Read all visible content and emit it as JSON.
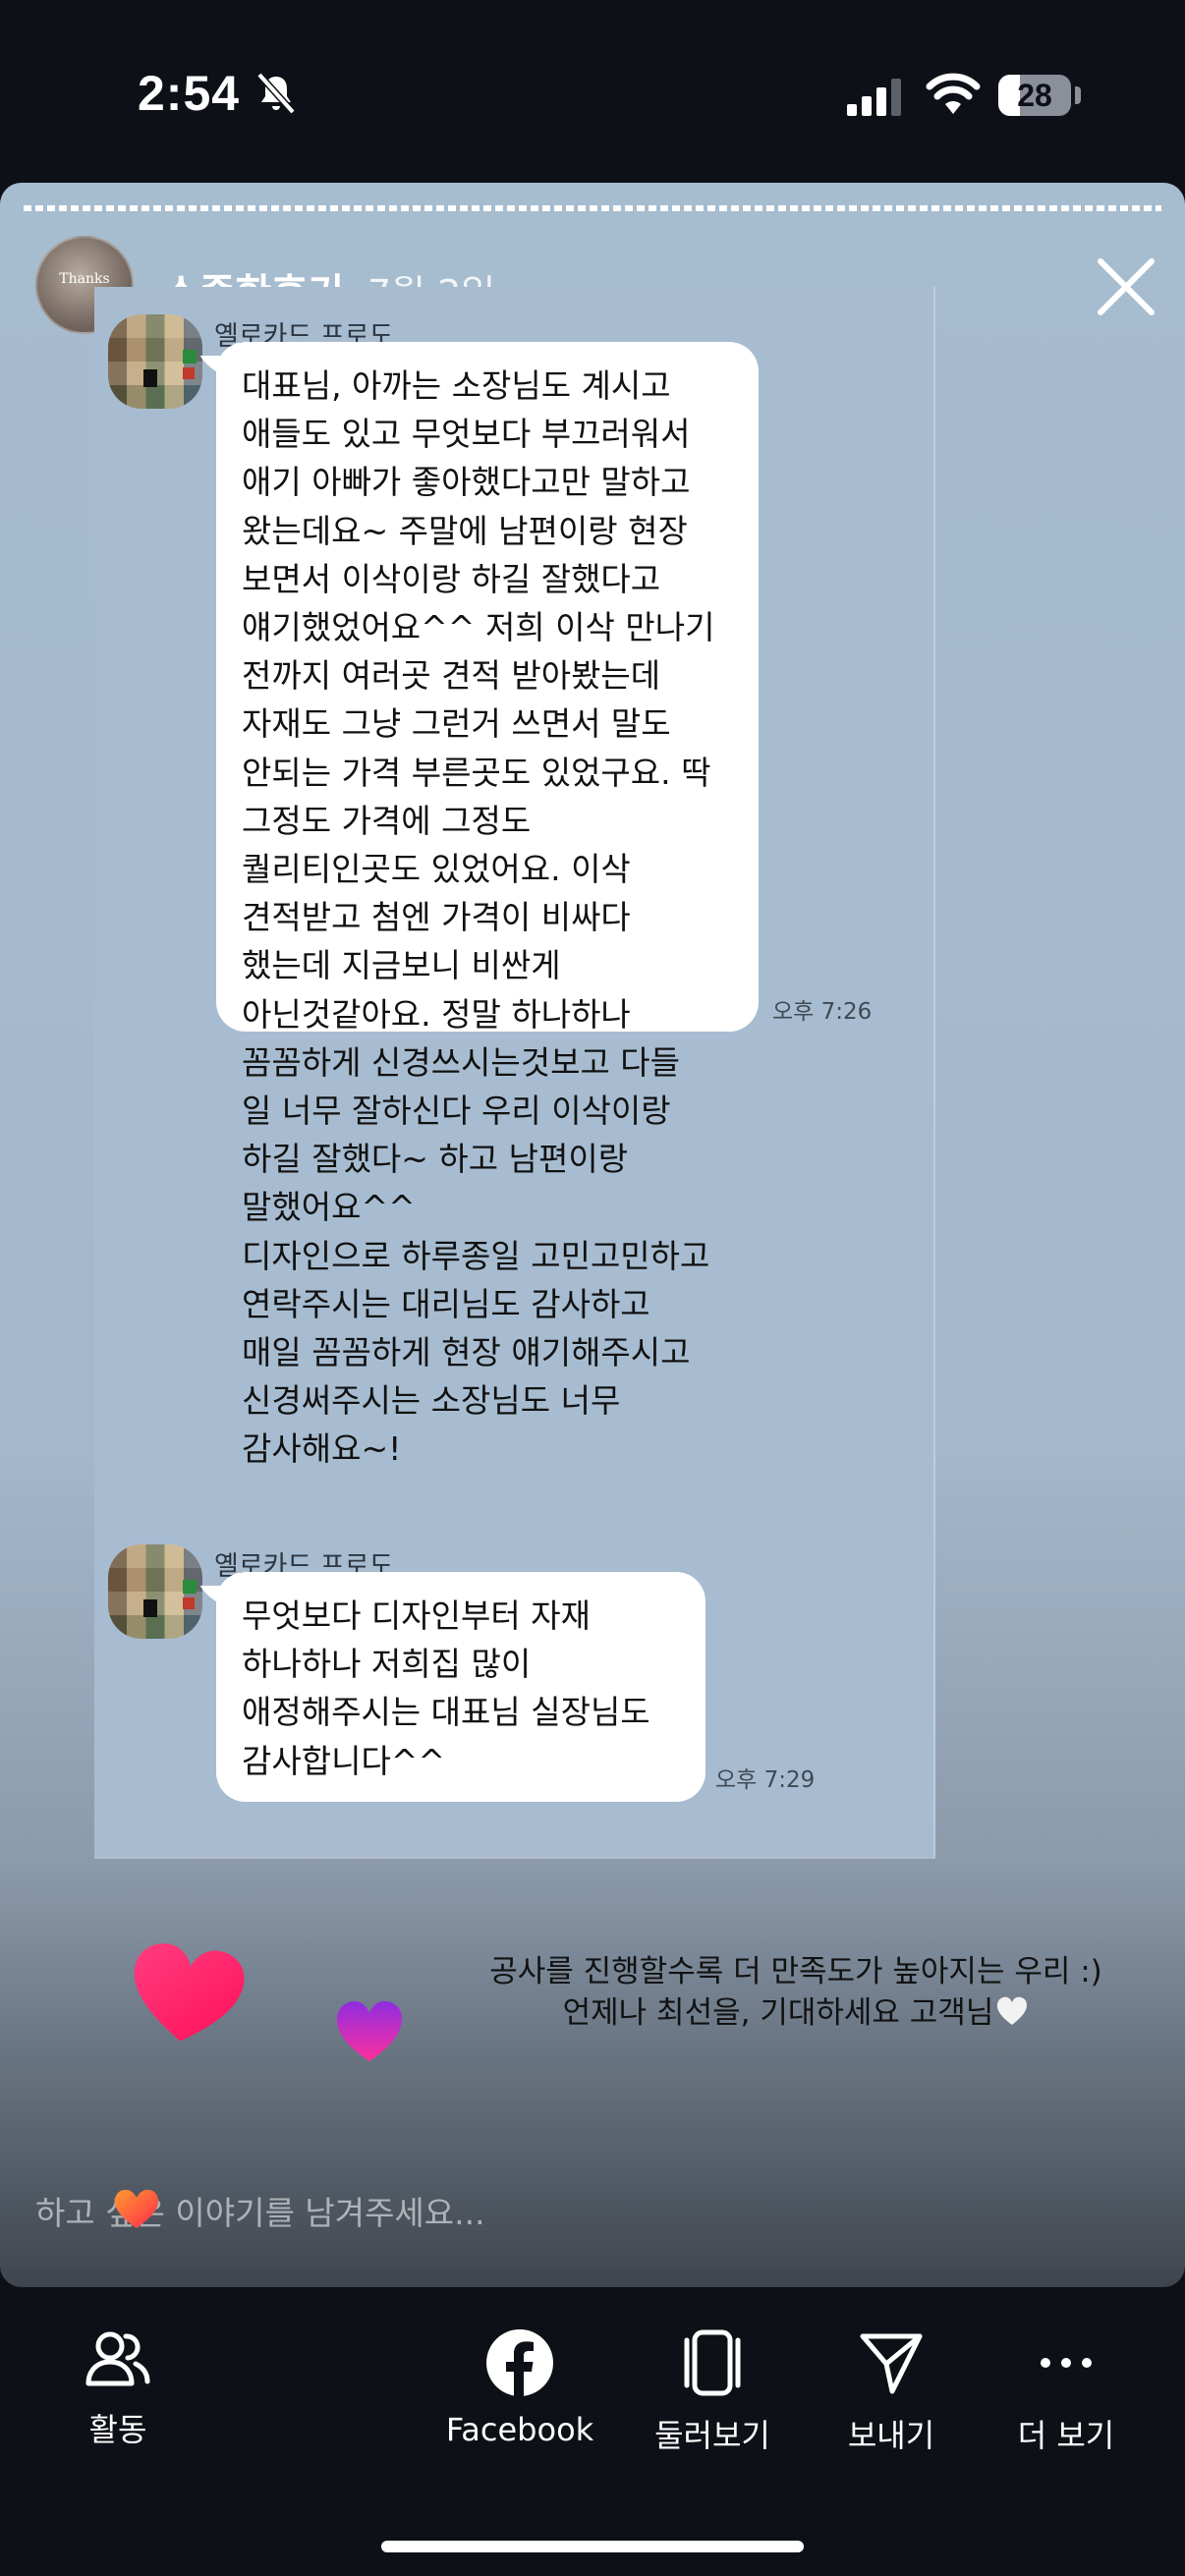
{
  "status_bar": {
    "time": "2:54",
    "battery": "28"
  },
  "story": {
    "author_avatar_text": "Thanks",
    "author_name": "소중한후기",
    "date": "7월 2일",
    "chat": {
      "messages": [
        {
          "sender": "옐로카드 프로도",
          "lines": [
            "대표님, 아까는 소장님도 계시고",
            "애들도 있고 무엇보다 부끄러워서",
            "애기 아빠가 좋아했다고만 말하고",
            "왔는데요~ 주말에 남편이랑 현장",
            "보면서 이삭이랑 하길 잘했다고",
            "얘기했었어요^^ 저희 이삭 만나기",
            "전까지 여러곳 견적 받아봤는데",
            "자재도 그냥 그런거 쓰면서 말도",
            "안되는 가격 부른곳도 있었구요. 딱",
            "그정도 가격에 그정도",
            "퀄리티인곳도 있었어요. 이삭",
            "견적받고 첨엔 가격이 비싸다",
            "했는데 지금보니 비싼게",
            "아닌것같아요. 정말 하나하나",
            "꼼꼼하게 신경쓰시는것보고 다들",
            "일 너무 잘하신다 우리 이삭이랑",
            "하길 잘했다~ 하고 남편이랑",
            "말했어요^^",
            "디자인으로 하루종일 고민고민하고",
            "연락주시는 대리님도 감사하고",
            "매일 꼼꼼하게 현장 얘기해주시고",
            "신경써주시는 소장님도 너무",
            "감사해요~!"
          ],
          "time": "오후 7:26"
        },
        {
          "sender": "옐로카드 프로도",
          "lines": [
            "무엇보다 디자인부터 자재",
            "하나하나 저희집 많이",
            "애정해주시는 대표님 실장님도",
            "감사합니다^^"
          ],
          "time": "오후 7:29"
        }
      ]
    },
    "caption_lines": [
      "공사를 진행할수록 더 만족도가 높아지는 우리 :)",
      "언제나 최선을, 기대하세요 고객님"
    ],
    "reply_placeholder": "하고 싶은 이야기를 남겨주세요..."
  },
  "bottom_nav": {
    "items": [
      {
        "label": "활동",
        "icon": "people-icon"
      },
      {
        "label": "Facebook",
        "icon": "facebook-icon"
      },
      {
        "label": "둘러보기",
        "icon": "browse-cards-icon"
      },
      {
        "label": "보내기",
        "icon": "send-icon"
      },
      {
        "label": "더 보기",
        "icon": "more-icon"
      }
    ]
  },
  "colors": {
    "chat_background": "#a7bcd0",
    "bubble": "#ffffff",
    "heart_pink": "#ff1f6b",
    "heart_purple": "#8e2de2"
  }
}
